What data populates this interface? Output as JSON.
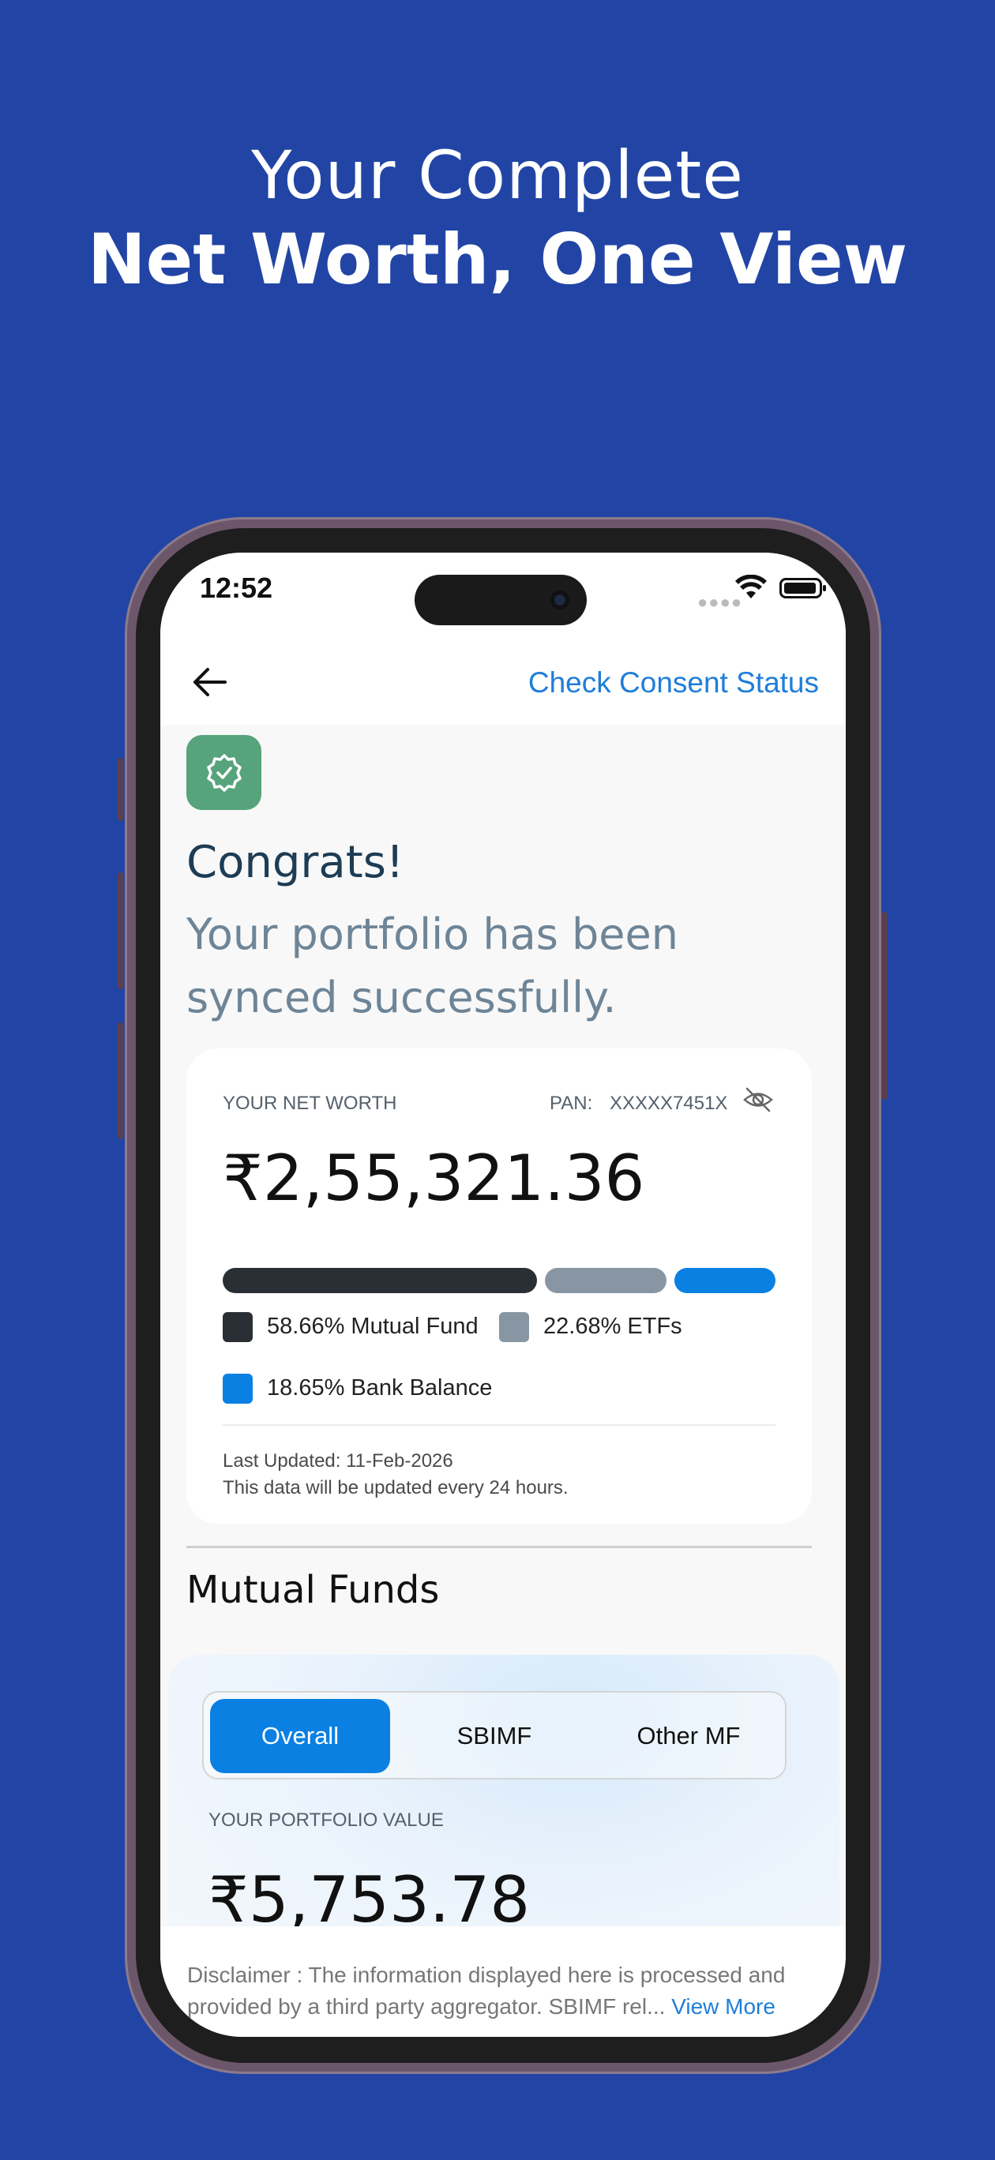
{
  "hero": {
    "line1": "Your Complete",
    "line2": "Net Worth, One View"
  },
  "status_bar": {
    "time": "12:52"
  },
  "nav": {
    "consent_link": "Check Consent Status"
  },
  "success": {
    "title": "Congrats!",
    "message": "Your portfolio has been synced successfully."
  },
  "net_worth": {
    "label": "YOUR NET WORTH",
    "pan_label": "PAN:",
    "pan_value": "XXXXX7451X",
    "value": "₹2,55,321.36",
    "allocation": [
      {
        "label": "58.66% Mutual Fund",
        "percent": 58.66,
        "color": "#2a2f36"
      },
      {
        "label": "22.68% ETFs",
        "percent": 22.68,
        "color": "#8896a3"
      },
      {
        "label": "18.65% Bank Balance",
        "percent": 18.65,
        "color": "#0a80e2"
      }
    ],
    "last_updated": "Last Updated: 11-Feb-2026",
    "update_note": "This data will be updated every 24 hours."
  },
  "mutual_funds": {
    "title": "Mutual Funds",
    "tabs": [
      "Overall",
      "SBIMF",
      "Other MF"
    ],
    "active_tab": "Overall",
    "portfolio_label": "YOUR PORTFOLIO VALUE",
    "portfolio_value": "₹5,753.78"
  },
  "disclaimer": {
    "text": "Disclaimer : The information displayed here is processed and provided by a third party aggregator. SBIMF rel...",
    "link": "View More"
  },
  "icons": [
    "back-arrow-icon",
    "verified-badge-icon",
    "eye-off-icon",
    "wifi-icon",
    "battery-icon"
  ]
}
